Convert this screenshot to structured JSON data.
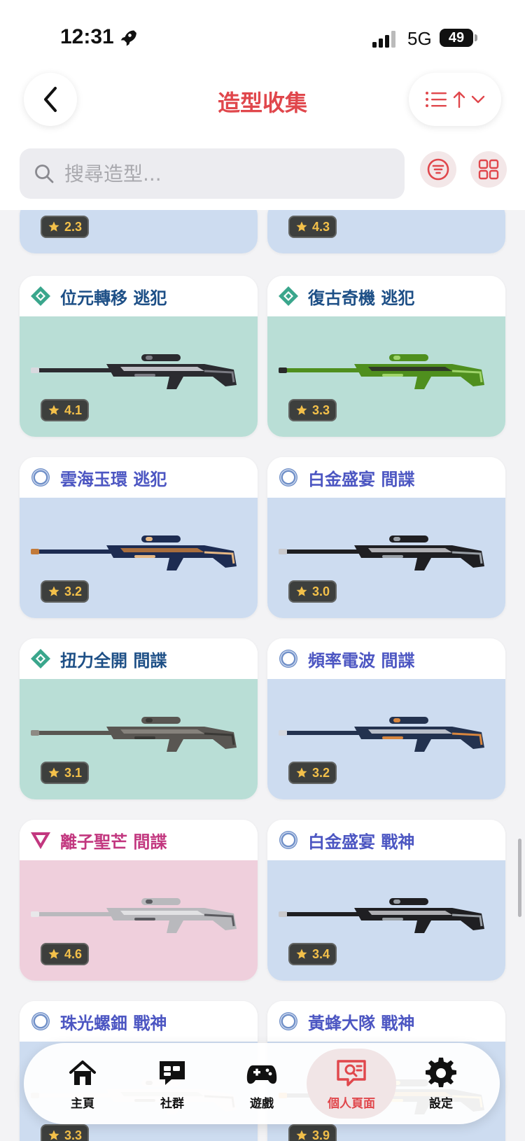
{
  "status_bar": {
    "time": "12:31",
    "network": "5G",
    "battery": "49"
  },
  "header": {
    "title": "造型收集",
    "search_placeholder": "搜尋造型..."
  },
  "partial_cards": [
    {
      "rating": "2.3",
      "bg": "#cddcf0"
    },
    {
      "rating": "4.3",
      "bg": "#cddcf0"
    }
  ],
  "cards": [
    {
      "name": "位元轉移 逃犯",
      "rating": "4.1",
      "tier": "teal-diamond-icon",
      "theme": "teal",
      "gun_colors": [
        "#2b2b30",
        "#d9d9df",
        "#7a7a82"
      ]
    },
    {
      "name": "復古奇機 逃犯",
      "rating": "3.3",
      "tier": "teal-diamond-icon",
      "theme": "teal",
      "gun_colors": [
        "#4f8f1e",
        "#2a2a2a",
        "#9fd46a"
      ]
    },
    {
      "name": "雲海玉環 逃犯",
      "rating": "3.2",
      "tier": "blue-ring-icon",
      "theme": "blue",
      "gun_colors": [
        "#1d2c52",
        "#c27a3a",
        "#e6b884"
      ]
    },
    {
      "name": "白金盛宴 間諜",
      "rating": "3.0",
      "tier": "blue-ring-icon",
      "theme": "blue",
      "gun_colors": [
        "#1f1f22",
        "#c9c9cc",
        "#9aa0a6"
      ]
    },
    {
      "name": "扭力全開 間諜",
      "rating": "3.1",
      "tier": "teal-diamond-icon",
      "theme": "teal",
      "gun_colors": [
        "#595652",
        "#8e8a84",
        "#3a3936"
      ]
    },
    {
      "name": "頻率電波 間諜",
      "rating": "3.2",
      "tier": "blue-ring-icon",
      "theme": "blue",
      "gun_colors": [
        "#23324f",
        "#d4d7de",
        "#d8863e"
      ]
    },
    {
      "name": "離子聖芒 間諜",
      "rating": "4.6",
      "tier": "pink-triangle-icon",
      "theme": "pink",
      "gun_colors": [
        "#b9b9bd",
        "#e8e8ea",
        "#5b5b60"
      ]
    },
    {
      "name": "白金盛宴 戰神",
      "rating": "3.4",
      "tier": "blue-ring-icon",
      "theme": "blue",
      "gun_colors": [
        "#1f1f22",
        "#c9c9cc",
        "#9aa0a6"
      ]
    },
    {
      "name": "珠光螺鈿 戰神",
      "rating": "3.3",
      "tier": "blue-ring-icon",
      "theme": "blue",
      "gun_colors": [
        "#e7e2d8",
        "#b0a79a",
        "#6d665c"
      ]
    },
    {
      "name": "黃蜂大隊 戰神",
      "rating": "3.9",
      "tier": "blue-ring-icon",
      "theme": "blue",
      "gun_colors": [
        "#2a2a2a",
        "#e68a1f",
        "#f2c14e"
      ]
    }
  ],
  "nav": [
    {
      "label": "主頁",
      "icon": "home-icon",
      "active": false
    },
    {
      "label": "社群",
      "icon": "chat-icon",
      "active": false
    },
    {
      "label": "遊戲",
      "icon": "gamepad-icon",
      "active": false
    },
    {
      "label": "個人頁面",
      "icon": "profile-search-icon",
      "active": true
    },
    {
      "label": "設定",
      "icon": "gear-icon",
      "active": false
    }
  ],
  "colors": {
    "accent": "#e0474c",
    "blue_bg": "#cddcf0",
    "teal_bg": "#b9ded6",
    "pink_bg": "#efcfdc"
  }
}
